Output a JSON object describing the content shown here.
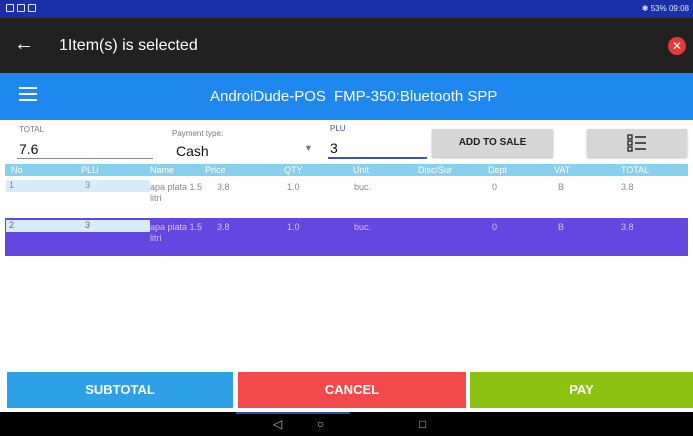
{
  "status_bar": {
    "time": "09:08",
    "battery": "53%"
  },
  "action_bar": {
    "back_icon": "arrow-left",
    "title": "1Item(s) is selected",
    "close_icon": "close"
  },
  "toolbar": {
    "menu_icon": "hamburger",
    "app_title": "AndroiDude-POS",
    "device": "FMP-350:Bluetooth SPP"
  },
  "fields": {
    "total_label": "TOTAL",
    "total_value": "7.6",
    "payment_label": "Payment type:",
    "payment_value": "Cash",
    "plu_label": "PLU",
    "plu_value": "3"
  },
  "buttons": {
    "add_to_sale": "ADD TO SALE",
    "list_icon": "list-icon"
  },
  "table": {
    "headers": [
      "No",
      "PLU",
      "Name",
      "Price",
      "QTY",
      "Unit",
      "Disc/Sur",
      "Dept",
      "VAT",
      "TOTAL"
    ],
    "rows": [
      {
        "no": "1",
        "plu": "3",
        "name1": "apa plata 1.5",
        "name2": "litri",
        "price": "3.8",
        "qty": "1.0",
        "unit": "buc.",
        "disc": "",
        "dept": "0",
        "vat": "B",
        "total": "3.8"
      },
      {
        "no": "2",
        "plu": "3",
        "name1": "apa plata 1.5",
        "name2": "litri",
        "price": "3.8",
        "qty": "1.0",
        "unit": "buc.",
        "disc": "",
        "dept": "0",
        "vat": "B",
        "total": "3.8"
      }
    ]
  },
  "bottom_buttons": {
    "subtotal": "SUBTOTAL",
    "cancel": "CANCEL",
    "pay": "PAY"
  },
  "colors": {
    "accent": "#1e88f0",
    "selected_row": "#6447e0",
    "subtotal": "#2ea0e8",
    "cancel": "#f24a4a",
    "pay": "#8cc312"
  }
}
